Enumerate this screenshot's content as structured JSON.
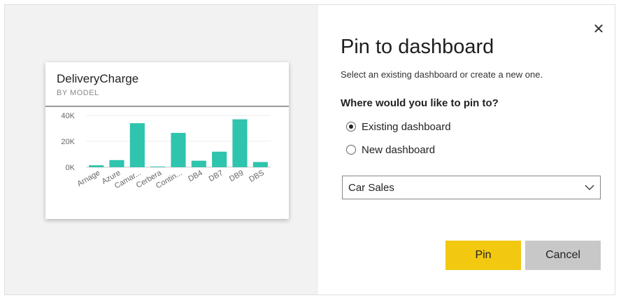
{
  "tile": {
    "title": "DeliveryCharge",
    "subtitle": "BY MODEL"
  },
  "chart_data": {
    "type": "bar",
    "categories": [
      "Arnage",
      "Azure",
      "Camar...",
      "Cerbera",
      "Contin...",
      "DB4",
      "DB7",
      "DB9",
      "DBS"
    ],
    "values": [
      1500,
      5500,
      34000,
      500,
      26500,
      5000,
      12000,
      37000,
      4000
    ],
    "ylim": [
      0,
      40000
    ],
    "yticks": [
      "40K",
      "20K",
      "0K"
    ],
    "ytick_values": [
      40000,
      20000,
      0
    ],
    "bar_color": "#2ec4ad",
    "grid": true
  },
  "dialog": {
    "title": "Pin to dashboard",
    "subtitle": "Select an existing dashboard or create a new one.",
    "question": "Where would you like to pin to?",
    "options": [
      {
        "label": "Existing dashboard",
        "selected": true
      },
      {
        "label": "New dashboard",
        "selected": false
      }
    ],
    "dashboard_select": {
      "value": "Car Sales"
    },
    "pin_label": "Pin",
    "cancel_label": "Cancel",
    "close_icon": "close-icon",
    "colors": {
      "pin": "#f2c811",
      "cancel": "#c8c8c8"
    }
  }
}
